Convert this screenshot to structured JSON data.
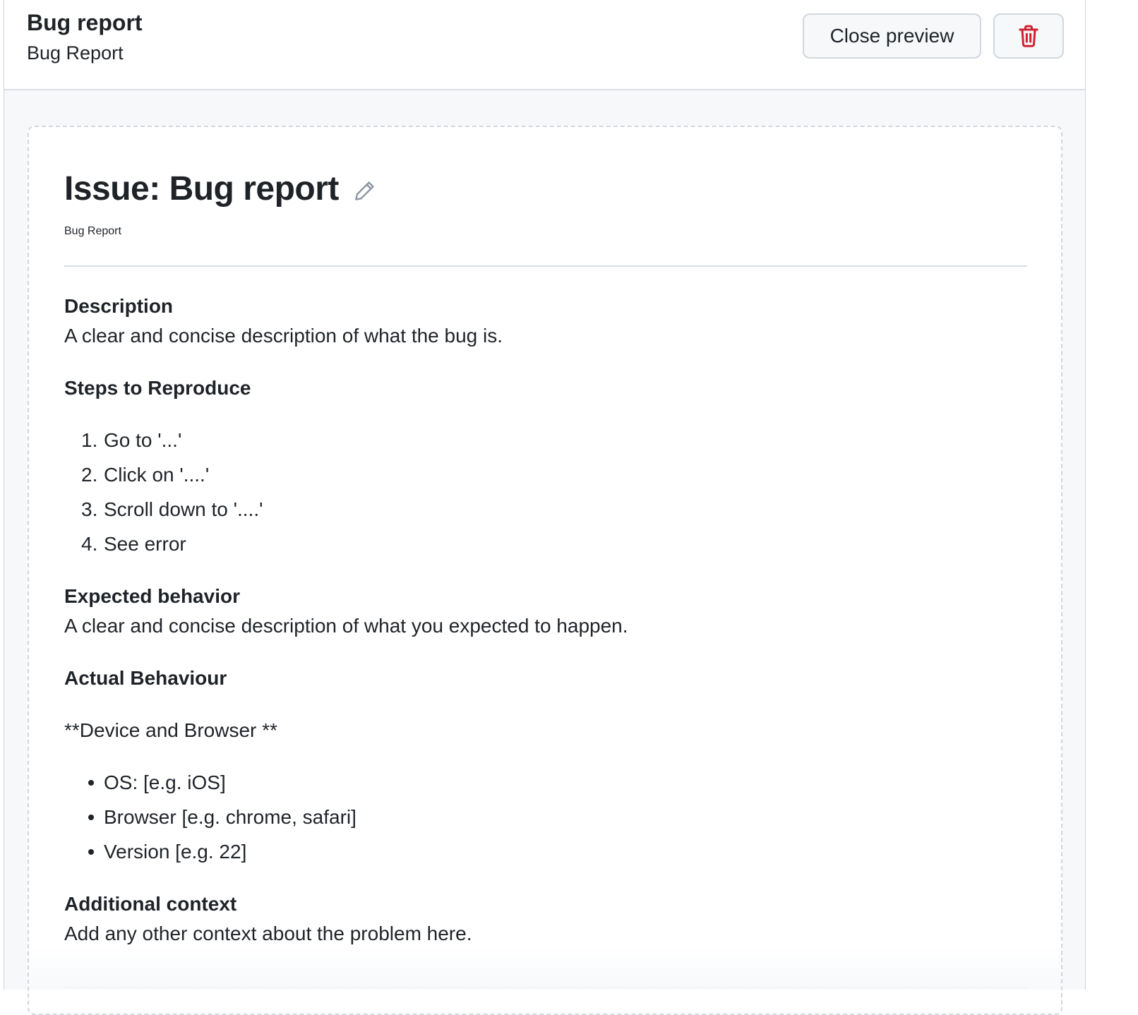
{
  "header": {
    "title": "Bug report",
    "subtitle": "Bug Report",
    "close_label": "Close preview",
    "delete_icon": "trash-icon",
    "delete_color": "#cf222e"
  },
  "issue": {
    "title": "Issue: Bug report",
    "edit_icon": "pencil-icon",
    "about": "Bug Report",
    "sections": {
      "description_heading": "Description",
      "description_text": "A clear and concise description of what the bug is.",
      "steps_heading": "Steps to Reproduce",
      "steps": [
        "Go to '...'",
        "Click on '....'",
        "Scroll down to '....'",
        "See error"
      ],
      "expected_heading": "Expected behavior",
      "expected_text": "A clear and concise description of what you expected to happen.",
      "actual_heading": "Actual Behaviour",
      "device_text": "**Device and Browser **",
      "device_items": [
        "OS: [e.g. iOS]",
        "Browser [e.g. chrome, safari]",
        "Version [e.g. 22]"
      ],
      "context_heading": "Additional context",
      "context_text": "Add any other context about the problem here."
    }
  }
}
